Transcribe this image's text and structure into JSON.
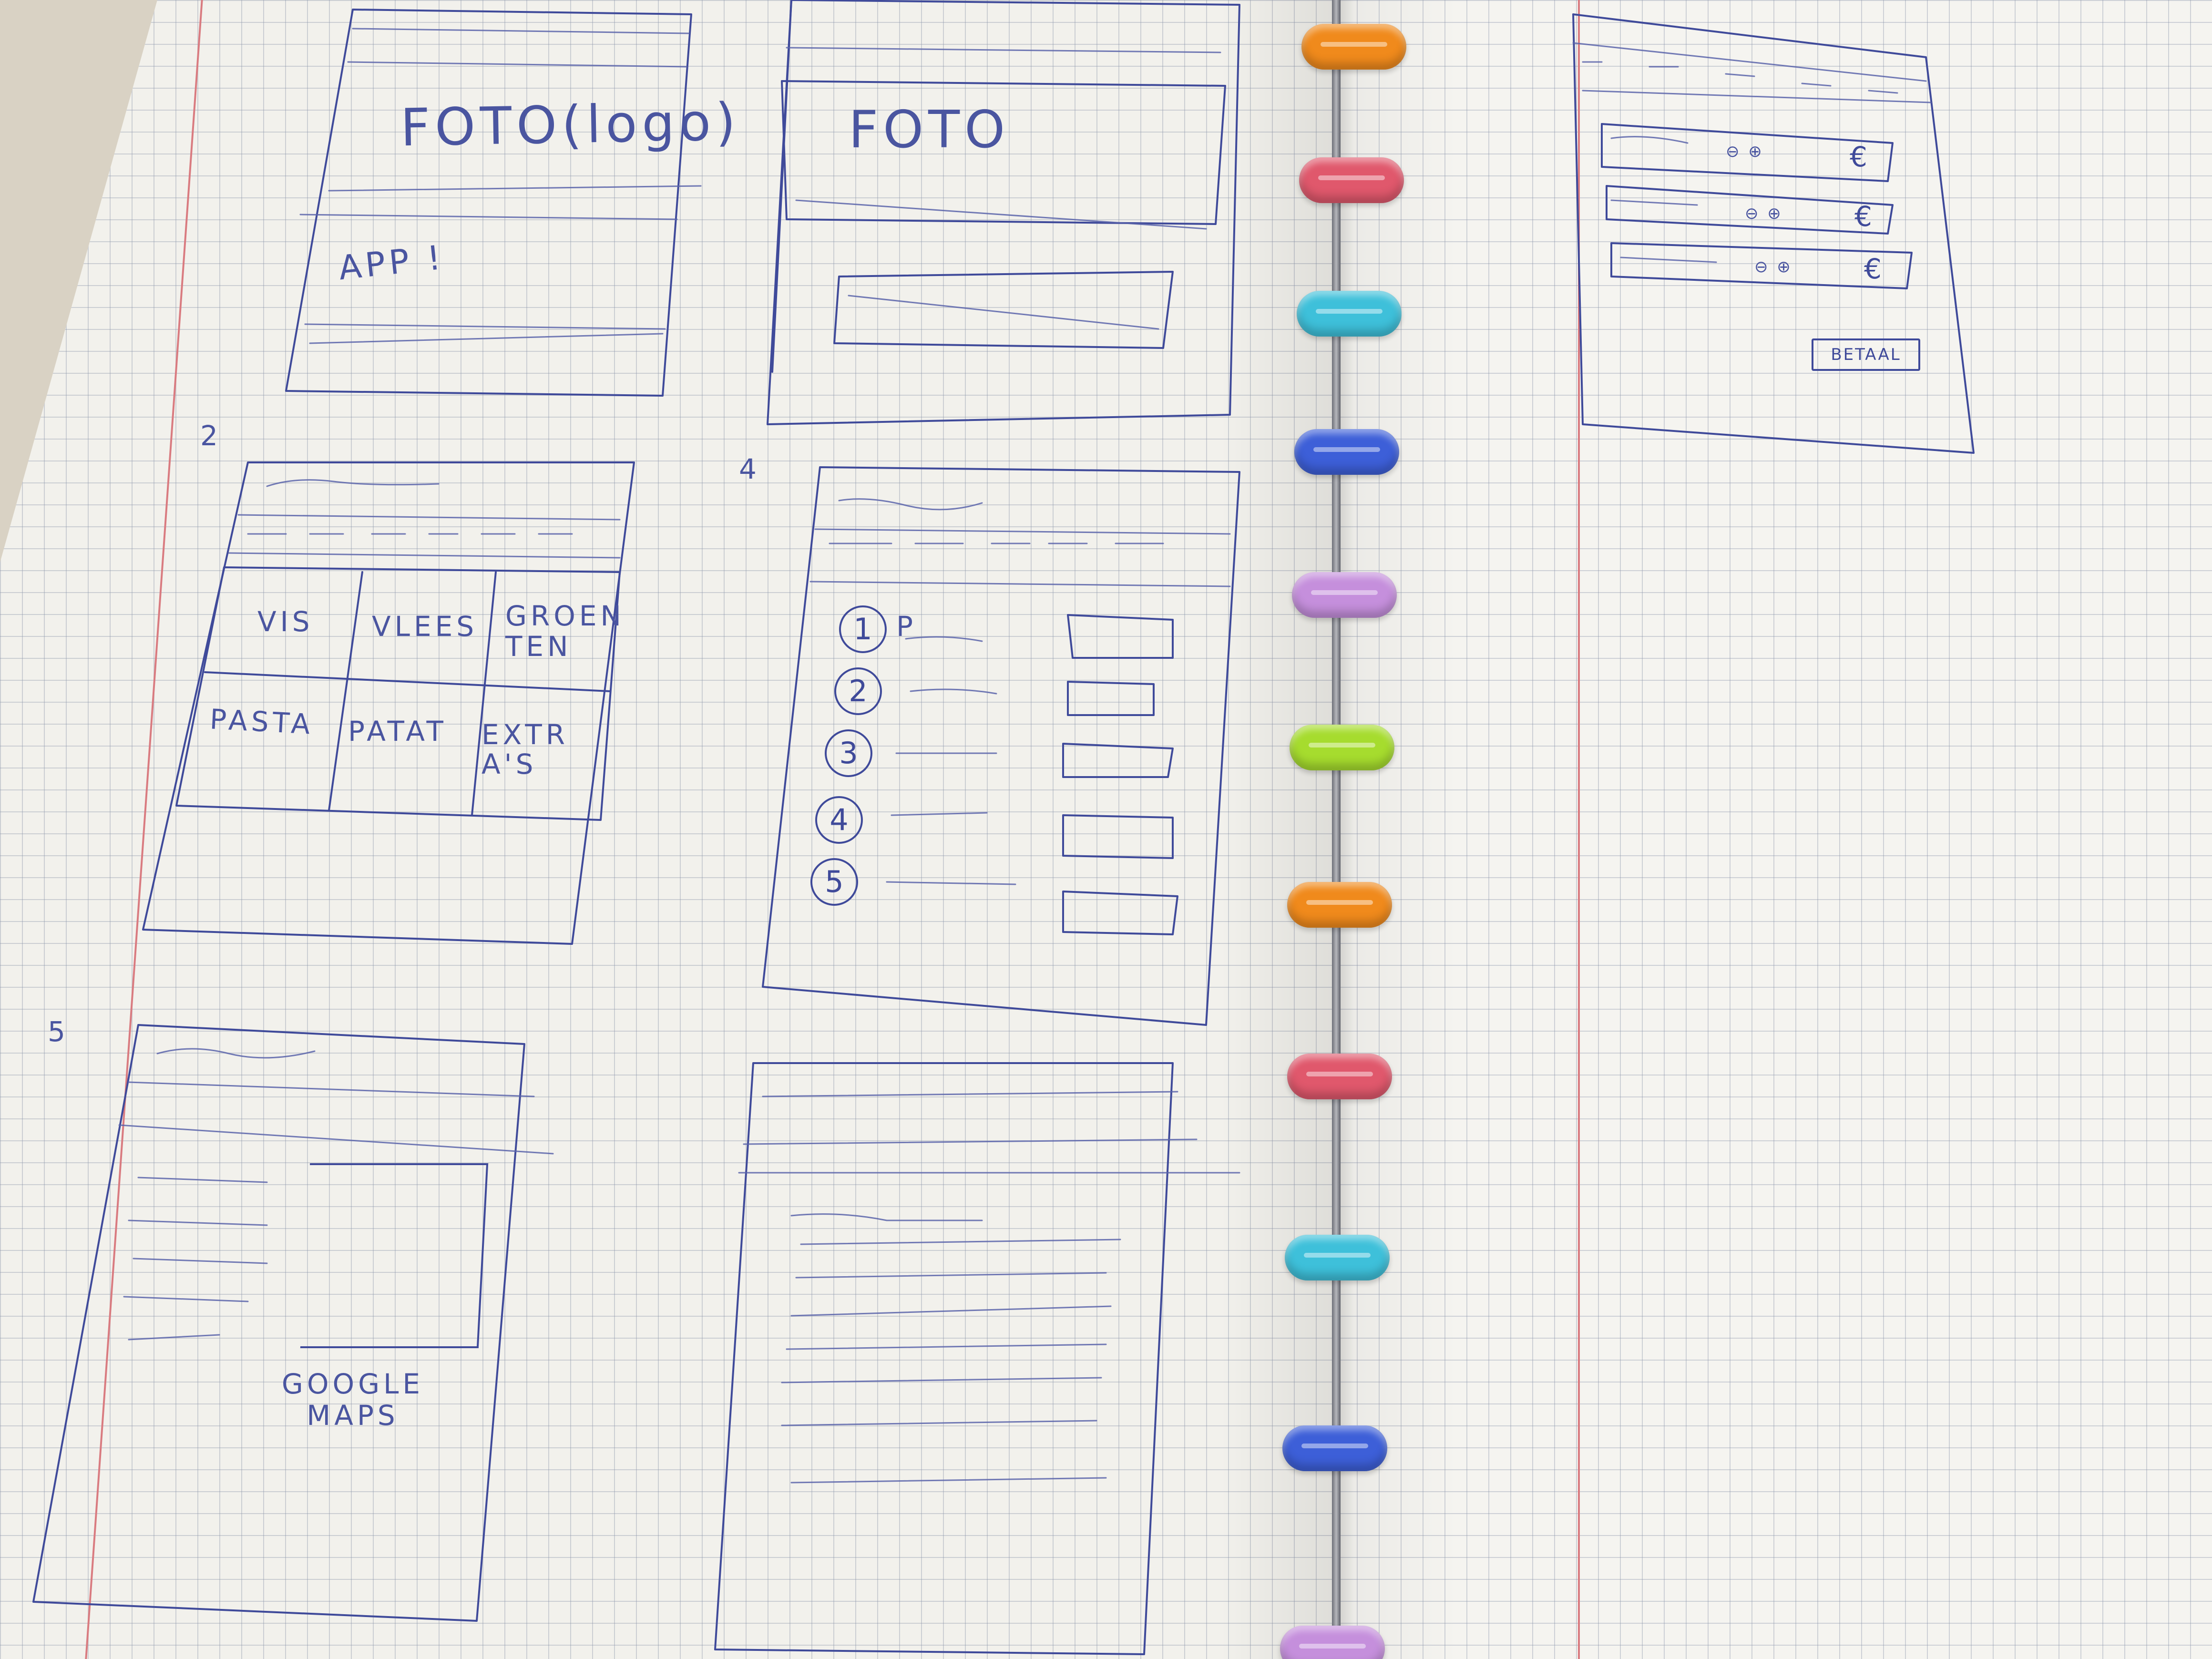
{
  "notebook": {
    "binder_ring_colors": [
      "#f08a1c",
      "#e0586c",
      "#3ec0da",
      "#3d5fd8",
      "#c58fdc",
      "#a6dc2e",
      "#f08a1c",
      "#e0586c",
      "#3ec0da",
      "#3d5fd8",
      "#c58fdc"
    ]
  },
  "sketches": {
    "screen1": {
      "photo_label": "FOTO(logo)",
      "app_label": "APP !"
    },
    "screen3": {
      "photo_label": "FOTO"
    },
    "screen2": {
      "number": "2",
      "grid_cells": [
        "VIS",
        "VLEES",
        "GROEN TEN",
        "PASTA",
        "PATAT",
        "EXTR A'S"
      ]
    },
    "screen4": {
      "number": "4",
      "list_numbers": [
        "1",
        "2",
        "3",
        "4",
        "5"
      ],
      "first_item_label": "P"
    },
    "screen5": {
      "number": "5",
      "maps_label": "GOOGLE MAPS"
    },
    "screen_cart": {
      "row_symbols": [
        "⊖ ⊕",
        "⊖ ⊕",
        "⊖ ⊕"
      ],
      "currency": "€",
      "pay_button": "BETAAL"
    }
  }
}
